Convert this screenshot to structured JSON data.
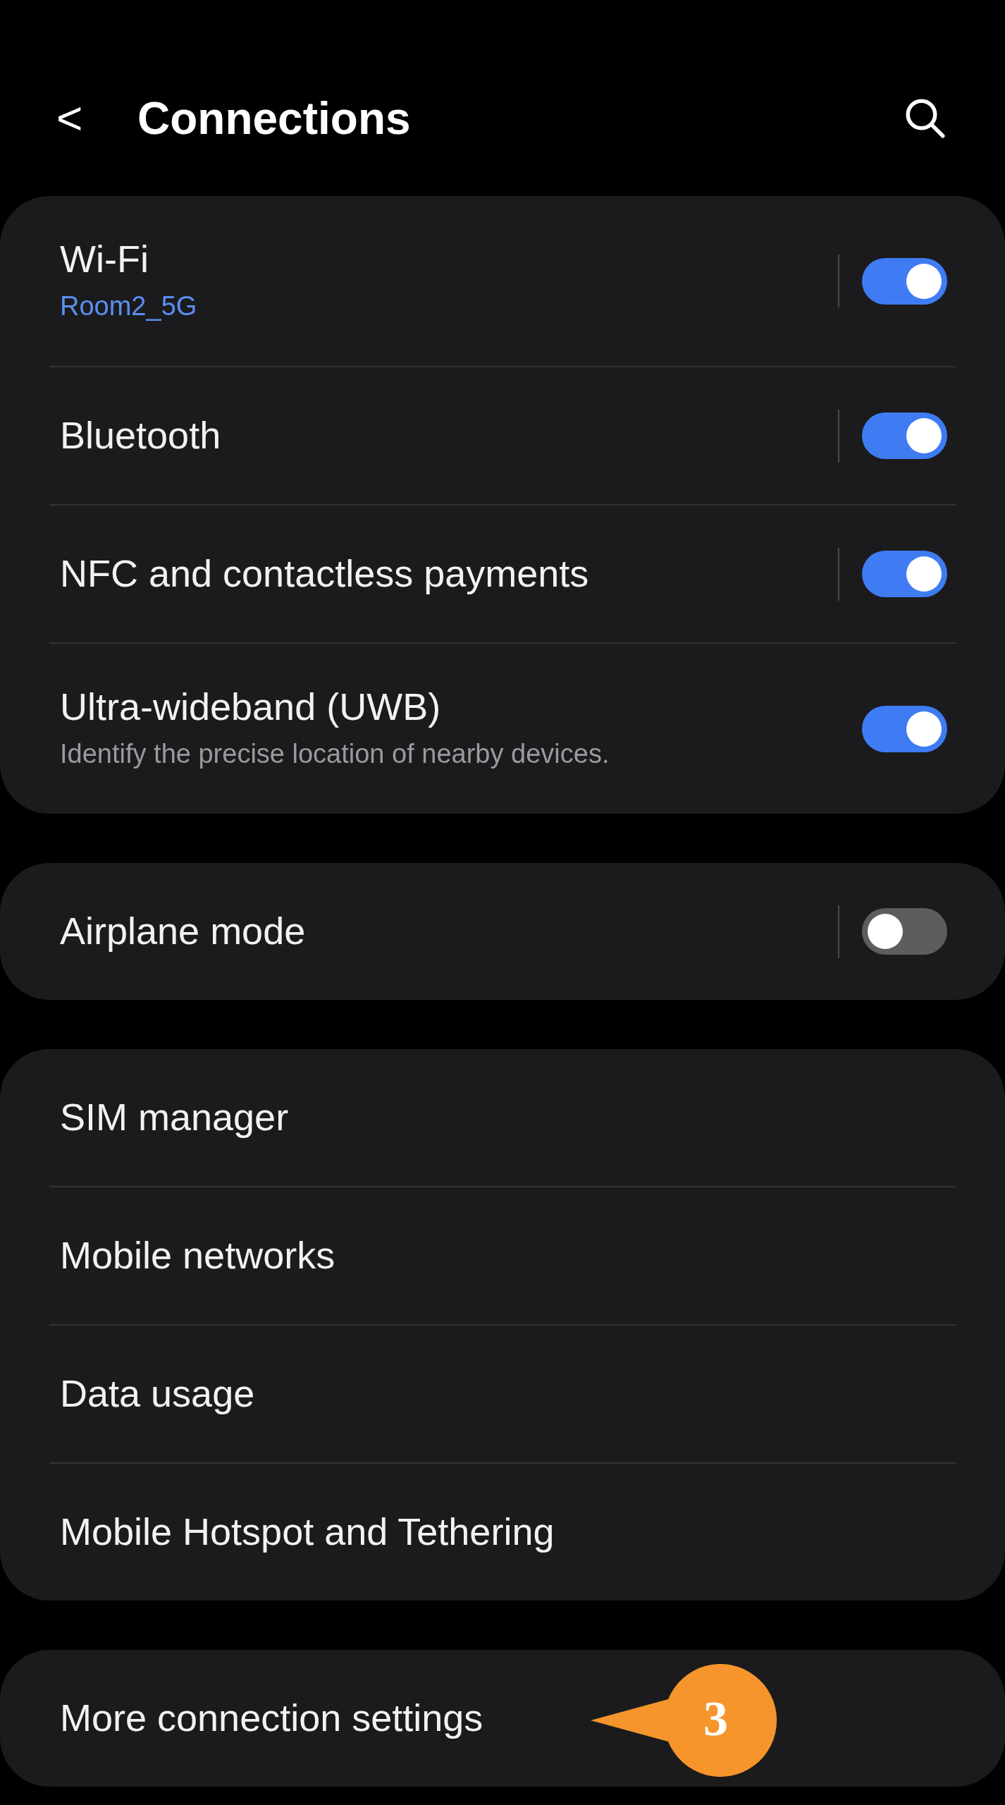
{
  "header": {
    "back": "<",
    "title": "Connections"
  },
  "groups": [
    {
      "items": [
        {
          "kind": "toggle",
          "label": "Wi-Fi",
          "status": "Room2_5G",
          "on": true,
          "separator": true
        },
        {
          "kind": "toggle",
          "label": "Bluetooth",
          "on": true,
          "separator": true
        },
        {
          "kind": "toggle",
          "label": "NFC and contactless payments",
          "on": true,
          "separator": true
        },
        {
          "kind": "toggle",
          "label": "Ultra-wideband (UWB)",
          "description": "Identify the precise location of nearby devices.",
          "on": true,
          "separator": false
        }
      ]
    },
    {
      "items": [
        {
          "kind": "toggle",
          "label": "Airplane mode",
          "on": false,
          "separator": true
        }
      ]
    },
    {
      "items": [
        {
          "kind": "link",
          "label": "SIM manager"
        },
        {
          "kind": "link",
          "label": "Mobile networks"
        },
        {
          "kind": "link",
          "label": "Data usage"
        },
        {
          "kind": "link",
          "label": "Mobile Hotspot and Tethering"
        }
      ]
    },
    {
      "items": [
        {
          "kind": "link",
          "label": "More connection settings",
          "callout": "3"
        }
      ]
    }
  ]
}
